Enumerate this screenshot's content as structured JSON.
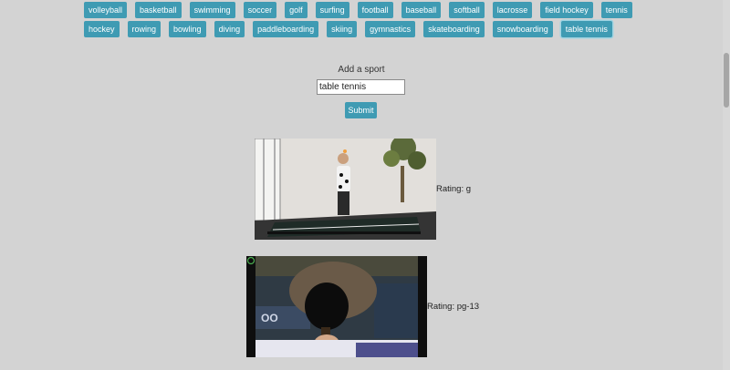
{
  "sports": {
    "row1": [
      "volleyball",
      "basketball",
      "swimming",
      "soccer",
      "golf",
      "surfing",
      "football",
      "baseball",
      "softball",
      "lacrosse",
      "field hockey",
      "tennis"
    ],
    "row2": [
      "hockey",
      "rowing",
      "bowling",
      "diving",
      "paddleboarding",
      "skiing",
      "gymnastics",
      "skateboarding",
      "snowboarding",
      "table tennis"
    ],
    "selected": "table tennis"
  },
  "form": {
    "label": "Add a sport",
    "input_value": "table tennis",
    "submit_label": "Submit"
  },
  "results": [
    {
      "rating": "Rating: g"
    },
    {
      "rating": "Rating: pg-13"
    }
  ],
  "colors": {
    "accent": "#3f9bb3",
    "background": "#d3d3d3"
  }
}
